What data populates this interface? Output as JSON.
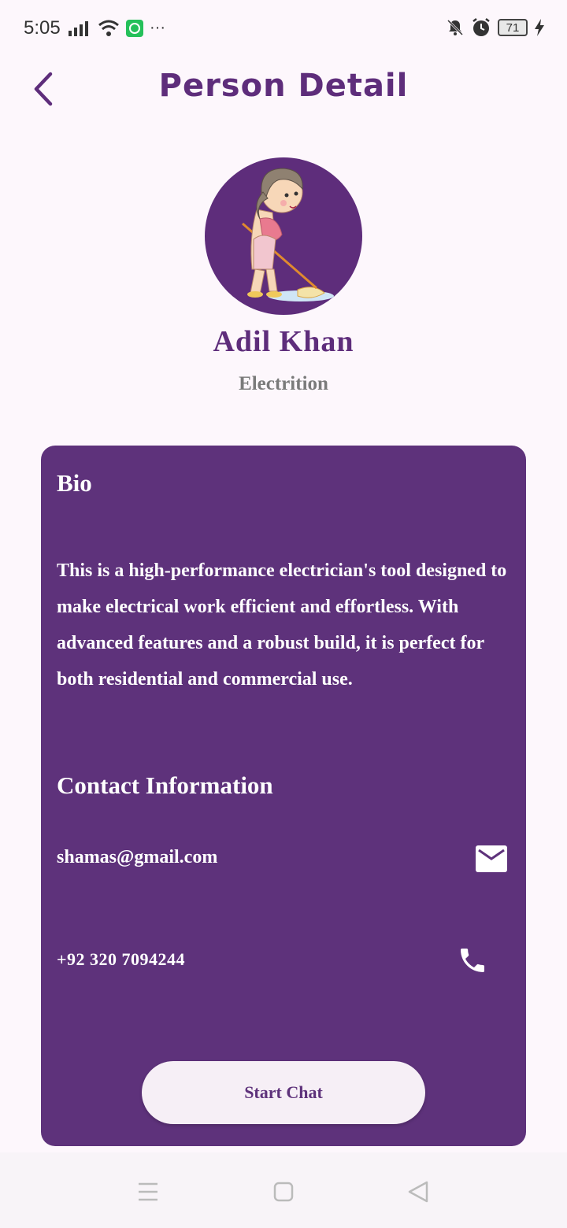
{
  "status_bar": {
    "time": "5:05",
    "more_label": "···",
    "battery_level": "71",
    "icons": [
      "signal-icon",
      "wifi-icon",
      "whatsapp-notification-icon",
      "notifications-off-icon",
      "alarm-icon",
      "battery-icon",
      "charging-icon"
    ]
  },
  "header": {
    "title": "Person Detail",
    "back_icon": "back-chevron-icon"
  },
  "profile": {
    "name": "Adil Khan",
    "profession": "Electrition",
    "avatar_icon": "cleaning-girl-illustration"
  },
  "bio": {
    "title": "Bio",
    "text": "This is a high-performance electrician's tool designed to make electrical work efficient and effortless. With advanced features and a robust build, it is perfect for both residential and commercial use."
  },
  "contact": {
    "title": "Contact Information",
    "email": "shamas@gmail.com",
    "phone": "+92 320 7094244"
  },
  "actions": {
    "start_chat_label": "Start Chat"
  },
  "colors": {
    "primary": "#5e327b",
    "background": "#fdf7fc",
    "button_bg": "#f6eff6",
    "secondary_text": "#7a7a7a"
  }
}
